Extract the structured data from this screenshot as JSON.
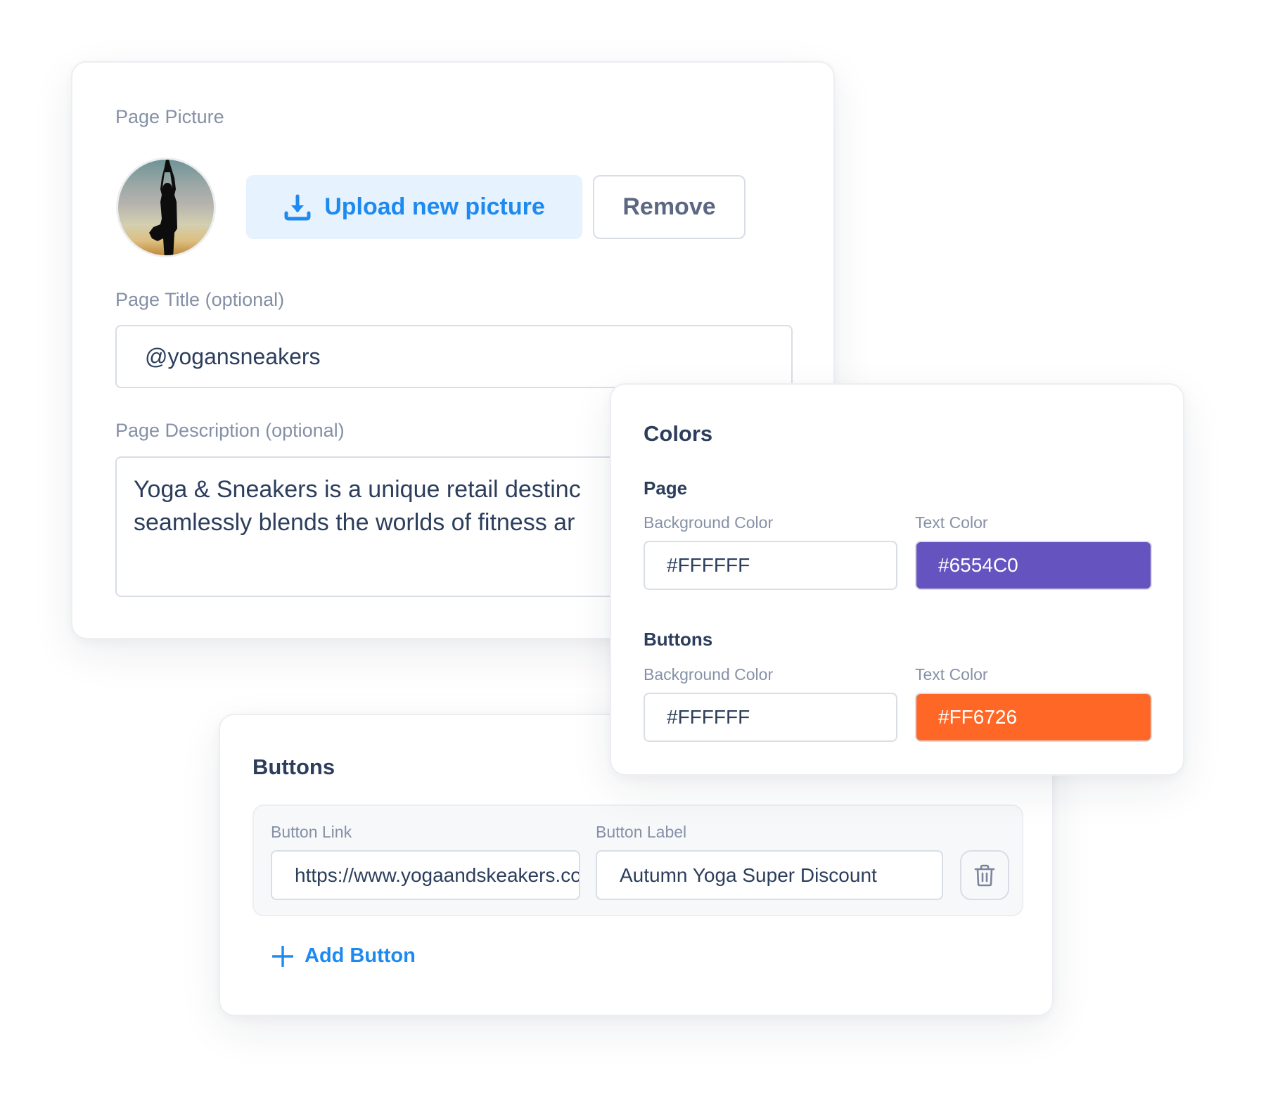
{
  "profile": {
    "picture_label": "Page Picture",
    "upload_button": {
      "label": "Upload new picture",
      "icon": "download-icon"
    },
    "remove_button": {
      "label": "Remove"
    },
    "title_label": "Page Title (optional)",
    "title_value": "@yogansneakers",
    "description_label": "Page Description (optional)",
    "description_lines": [
      "Yoga & Sneakers is a unique retail destinc",
      "seamlessly blends the worlds of fitness ar"
    ]
  },
  "colors": {
    "heading": "Colors",
    "page": {
      "heading": "Page",
      "background_label": "Background Color",
      "background_value": "#FFFFFF",
      "text_label": "Text Color",
      "text_value": "#6554C0"
    },
    "buttons": {
      "heading": "Buttons",
      "background_label": "Background Color",
      "background_value": "#FFFFFF",
      "text_label": "Text Color",
      "text_value": "#FF6726"
    }
  },
  "buttons_section": {
    "heading": "Buttons",
    "items": [
      {
        "link_label": "Button Link",
        "link_value": "https://www.yogaandskeakers.com/p",
        "button_label_label": "Button Label",
        "button_label_value": "Autumn Yoga Super Discount",
        "delete_icon": "trash-icon"
      }
    ],
    "add_button": {
      "label": "Add Button",
      "icon": "plus-icon"
    }
  },
  "theme": {
    "accent": "#1E8AF0",
    "accent_bg": "#E6F2FD",
    "text_dark": "#2C3E5C",
    "text_muted": "#8590A6"
  }
}
